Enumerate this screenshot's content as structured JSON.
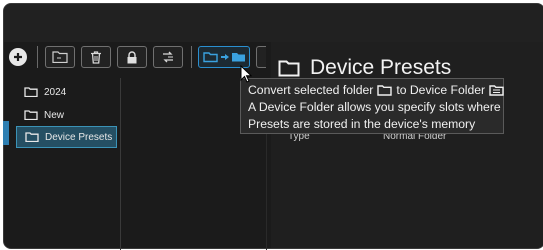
{
  "tree": {
    "items": [
      {
        "label": "2024"
      },
      {
        "label": "New"
      },
      {
        "label": "Device Presets"
      }
    ]
  },
  "details": {
    "title": "Device Presets",
    "property_key": "Type",
    "property_value": "Normal Folder"
  },
  "tooltip": {
    "line1_a": "Convert selected folder",
    "line1_b": "to Device Folder",
    "line2": "A Device Folder allows you specify slots where",
    "line3": "Presets are stored in the device's memory"
  },
  "colors": {
    "accent": "#2e7fb2",
    "selection": "#254f63",
    "active_button": "#2a8fd0"
  }
}
